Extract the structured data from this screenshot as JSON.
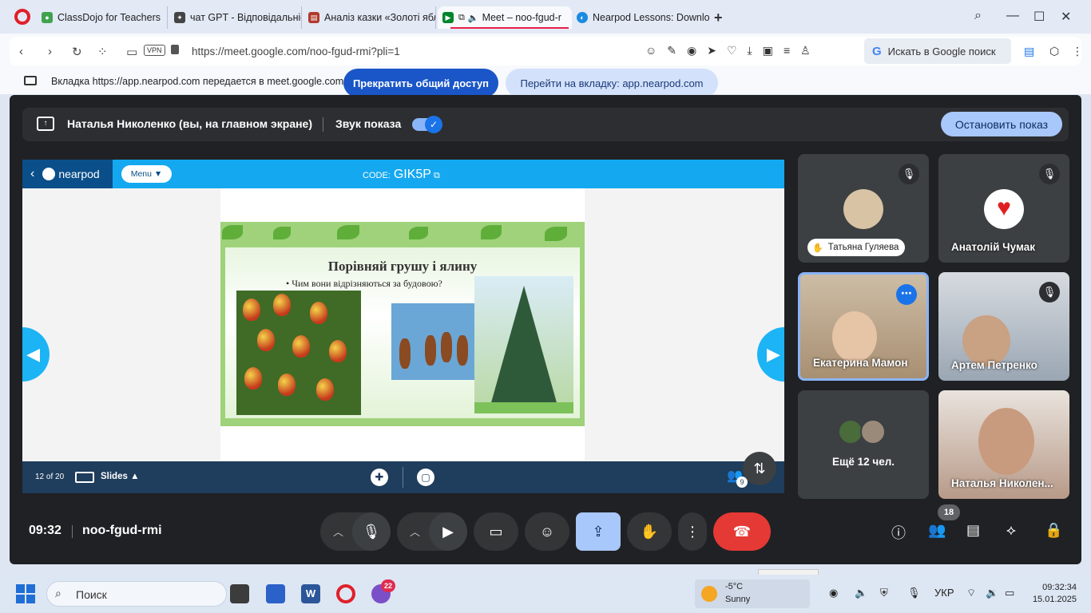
{
  "browser": {
    "tabs": [
      {
        "title": "ClassDojo for Teachers",
        "icon_color": "#3fa34d"
      },
      {
        "title": "чат GPT - Відповідальніст",
        "icon_color": "#444444"
      },
      {
        "title": "Аналіз казки «Золоті ябл",
        "icon_color": "#b03a2e"
      },
      {
        "title": "Meet – noo-fgud-r",
        "icon_color": "#00832d",
        "active": true
      },
      {
        "title": "Nearpod Lessons: Downlo",
        "icon_color": "#1a8be0"
      }
    ],
    "new_tab": "+",
    "url": "https://meet.google.com/noo-fgud-rmi?pli=1",
    "vpn_label": "VPN",
    "search_label": "Искать в Google поиск",
    "google_g": "G"
  },
  "share_notice": {
    "message": "Вкладка https://app.nearpod.com передается в meet.google.com",
    "stop_label": "Прекратить общий доступ",
    "goto_label": "Перейти на вкладку: app.nearpod.com"
  },
  "presenting": {
    "name": "Наталья Николенко (вы, на главном экране)",
    "sound_label": "Звук показа",
    "stop_show_label": "Остановить показ"
  },
  "nearpod": {
    "logo_text": "nearpod",
    "menu_label": "Menu ▼",
    "code_prefix": "CODE:",
    "code": "GIK5P",
    "slide_title": "Порівняй грушу і ялину",
    "slide_question": "•  Чим вони відрізняються  за будовою?",
    "slide_counter": "12 of 20",
    "slides_label": "Slides ▲",
    "participants_badge": "9"
  },
  "participants": [
    {
      "name": "Татьяна Гуляева",
      "muted": true,
      "avatar_color": "#d8c3a5"
    },
    {
      "name": "Анатолій Чумак",
      "muted": true,
      "avatar_color": "#ffffff"
    },
    {
      "name": "Екатерина Мамон",
      "selected": true
    },
    {
      "name": "Артем Петренко",
      "muted": true
    },
    {
      "more_label": "Ещё 12 чел."
    },
    {
      "name": "Наталья Николен..."
    }
  ],
  "meeting": {
    "time": "09:32",
    "code": "noo-fgud-rmi",
    "people_count": "18"
  },
  "tooltip": "-5°C Sunny",
  "taskbar": {
    "search_label": "Поиск",
    "viber_badge": "22",
    "weather_temp": "-5°C",
    "weather_cond": "Sunny",
    "lang": "УКР",
    "time": "09:32:34",
    "date": "15.01.2025"
  }
}
